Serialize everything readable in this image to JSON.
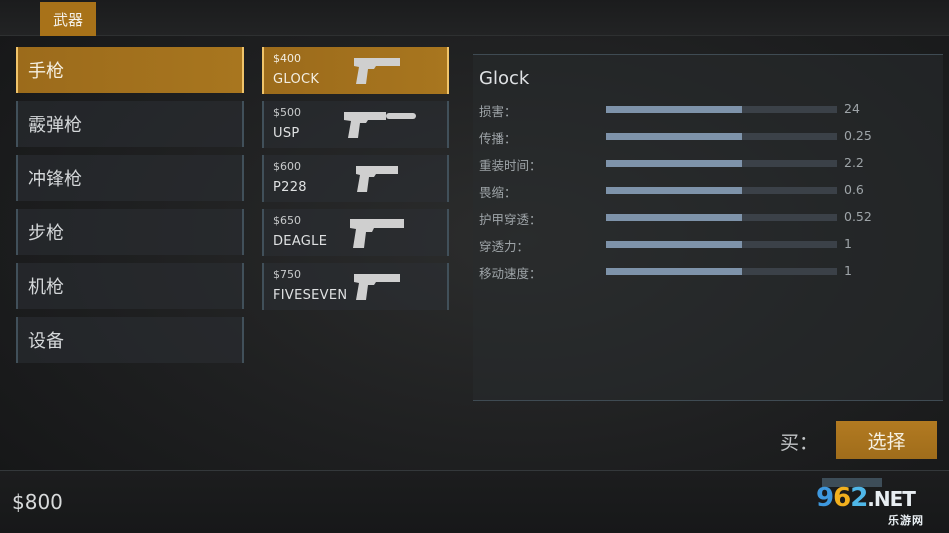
{
  "header": {
    "tab_label": "武器"
  },
  "categories": [
    {
      "label": "手枪",
      "active": true
    },
    {
      "label": "霰弹枪",
      "active": false
    },
    {
      "label": "冲锋枪",
      "active": false
    },
    {
      "label": "步枪",
      "active": false
    },
    {
      "label": "机枪",
      "active": false
    },
    {
      "label": "设备",
      "active": false
    }
  ],
  "weapons": [
    {
      "price": "$400",
      "name": "GLOCK",
      "active": true,
      "icon": "pistol-icon"
    },
    {
      "price": "$500",
      "name": "USP",
      "active": false,
      "icon": "silenced-pistol-icon"
    },
    {
      "price": "$600",
      "name": "P228",
      "active": false,
      "icon": "pistol-icon"
    },
    {
      "price": "$650",
      "name": "DEAGLE",
      "active": false,
      "icon": "pistol-icon"
    },
    {
      "price": "$750",
      "name": "FIVESEVEN",
      "active": false,
      "icon": "pistol-icon"
    }
  ],
  "stats": {
    "title": "Glock",
    "rows": [
      {
        "label": "损害：",
        "value": "24",
        "fill": 0.59
      },
      {
        "label": "传播：",
        "value": "0.25",
        "fill": 0.59
      },
      {
        "label": "重装时间：",
        "value": "2.2",
        "fill": 0.59
      },
      {
        "label": "畏缩：",
        "value": "0.6",
        "fill": 0.59
      },
      {
        "label": "护甲穿透：",
        "value": "0.52",
        "fill": 0.59
      },
      {
        "label": "穿透力：",
        "value": "1",
        "fill": 0.59
      },
      {
        "label": "移动速度：",
        "value": "1",
        "fill": 0.59
      }
    ]
  },
  "buy": {
    "label": "买：",
    "select_label": "选择"
  },
  "footer": {
    "money": "$800"
  },
  "watermark": {
    "part1": "9",
    "part2": "6",
    "part3": "2",
    "suffix": ".NET",
    "sub": "乐游网"
  },
  "colors": {
    "accent": "#a87219",
    "accent_border": "#f0c46a",
    "bar_fill": "#7e93aa",
    "bar_track": "#3b4148"
  }
}
